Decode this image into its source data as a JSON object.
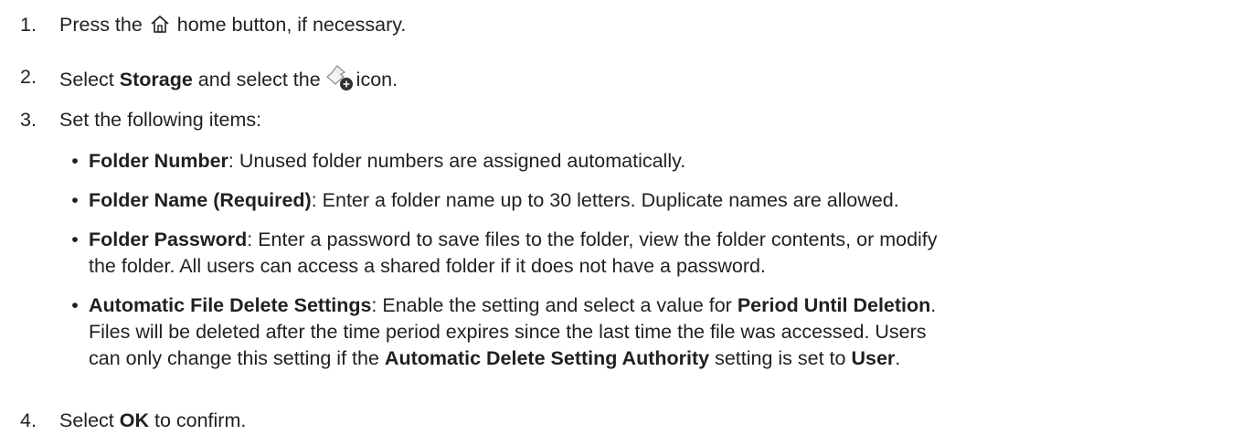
{
  "steps": [
    {
      "number": "1.",
      "before_icon": "Press the",
      "icon": "home-icon",
      "after_icon": "home button, if necessary."
    },
    {
      "number": "2.",
      "prefix": "Select",
      "bold": "Storage",
      "middle": "and select the",
      "icon": "storage-add-folder-icon",
      "suffix": "icon."
    },
    {
      "number": "3.",
      "text": "Set the following items:",
      "bullets": [
        {
          "term": "Folder Number",
          "text": ": Unused folder numbers are assigned automatically."
        },
        {
          "term": "Folder Name (Required)",
          "text": ": Enter a folder name up to 30 letters. Duplicate names are allowed."
        },
        {
          "term": "Folder Password",
          "text_line1": ": Enter a password to save files to the folder, view the folder contents, or modify",
          "text_line2": "the folder. All users can access a shared folder if it does not have a password."
        },
        {
          "term": "Automatic File Delete Settings",
          "text_a": ": Enable the setting and select a value for",
          "term_b": "Period Until Deletion",
          "text_b": ".",
          "text_line2": "Files will be deleted after the time period expires since the last time the file was accessed. Users",
          "text_c": "can only change this setting if the",
          "term_c": "Automatic Delete Setting Authority",
          "text_d": "setting is set to",
          "term_d": "User",
          "text_e": "."
        }
      ]
    },
    {
      "number": "4.",
      "prefix": "Select",
      "bold": "OK",
      "suffix": "to confirm."
    }
  ]
}
